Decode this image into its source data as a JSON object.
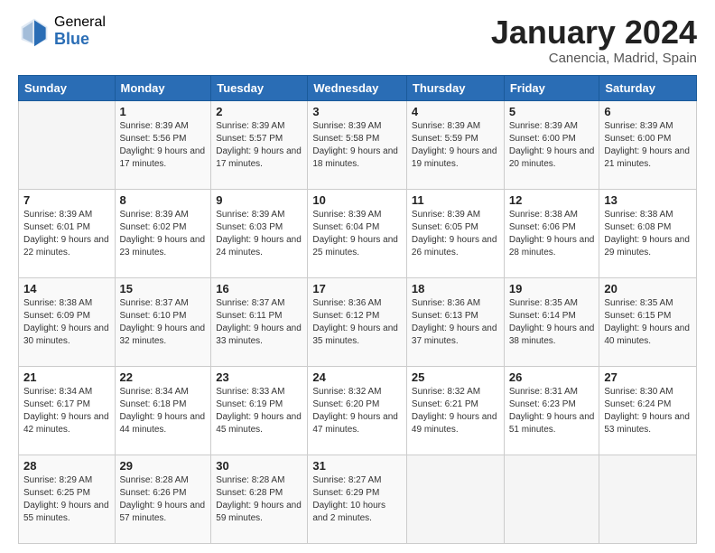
{
  "header": {
    "logo_general": "General",
    "logo_blue": "Blue",
    "month_title": "January 2024",
    "location": "Canencia, Madrid, Spain"
  },
  "weekdays": [
    "Sunday",
    "Monday",
    "Tuesday",
    "Wednesday",
    "Thursday",
    "Friday",
    "Saturday"
  ],
  "weeks": [
    [
      {
        "day": "",
        "sunrise": "",
        "sunset": "",
        "daylight": ""
      },
      {
        "day": "1",
        "sunrise": "Sunrise: 8:39 AM",
        "sunset": "Sunset: 5:56 PM",
        "daylight": "Daylight: 9 hours and 17 minutes."
      },
      {
        "day": "2",
        "sunrise": "Sunrise: 8:39 AM",
        "sunset": "Sunset: 5:57 PM",
        "daylight": "Daylight: 9 hours and 17 minutes."
      },
      {
        "day": "3",
        "sunrise": "Sunrise: 8:39 AM",
        "sunset": "Sunset: 5:58 PM",
        "daylight": "Daylight: 9 hours and 18 minutes."
      },
      {
        "day": "4",
        "sunrise": "Sunrise: 8:39 AM",
        "sunset": "Sunset: 5:59 PM",
        "daylight": "Daylight: 9 hours and 19 minutes."
      },
      {
        "day": "5",
        "sunrise": "Sunrise: 8:39 AM",
        "sunset": "Sunset: 6:00 PM",
        "daylight": "Daylight: 9 hours and 20 minutes."
      },
      {
        "day": "6",
        "sunrise": "Sunrise: 8:39 AM",
        "sunset": "Sunset: 6:00 PM",
        "daylight": "Daylight: 9 hours and 21 minutes."
      }
    ],
    [
      {
        "day": "7",
        "sunrise": "Sunrise: 8:39 AM",
        "sunset": "Sunset: 6:01 PM",
        "daylight": "Daylight: 9 hours and 22 minutes."
      },
      {
        "day": "8",
        "sunrise": "Sunrise: 8:39 AM",
        "sunset": "Sunset: 6:02 PM",
        "daylight": "Daylight: 9 hours and 23 minutes."
      },
      {
        "day": "9",
        "sunrise": "Sunrise: 8:39 AM",
        "sunset": "Sunset: 6:03 PM",
        "daylight": "Daylight: 9 hours and 24 minutes."
      },
      {
        "day": "10",
        "sunrise": "Sunrise: 8:39 AM",
        "sunset": "Sunset: 6:04 PM",
        "daylight": "Daylight: 9 hours and 25 minutes."
      },
      {
        "day": "11",
        "sunrise": "Sunrise: 8:39 AM",
        "sunset": "Sunset: 6:05 PM",
        "daylight": "Daylight: 9 hours and 26 minutes."
      },
      {
        "day": "12",
        "sunrise": "Sunrise: 8:38 AM",
        "sunset": "Sunset: 6:06 PM",
        "daylight": "Daylight: 9 hours and 28 minutes."
      },
      {
        "day": "13",
        "sunrise": "Sunrise: 8:38 AM",
        "sunset": "Sunset: 6:08 PM",
        "daylight": "Daylight: 9 hours and 29 minutes."
      }
    ],
    [
      {
        "day": "14",
        "sunrise": "Sunrise: 8:38 AM",
        "sunset": "Sunset: 6:09 PM",
        "daylight": "Daylight: 9 hours and 30 minutes."
      },
      {
        "day": "15",
        "sunrise": "Sunrise: 8:37 AM",
        "sunset": "Sunset: 6:10 PM",
        "daylight": "Daylight: 9 hours and 32 minutes."
      },
      {
        "day": "16",
        "sunrise": "Sunrise: 8:37 AM",
        "sunset": "Sunset: 6:11 PM",
        "daylight": "Daylight: 9 hours and 33 minutes."
      },
      {
        "day": "17",
        "sunrise": "Sunrise: 8:36 AM",
        "sunset": "Sunset: 6:12 PM",
        "daylight": "Daylight: 9 hours and 35 minutes."
      },
      {
        "day": "18",
        "sunrise": "Sunrise: 8:36 AM",
        "sunset": "Sunset: 6:13 PM",
        "daylight": "Daylight: 9 hours and 37 minutes."
      },
      {
        "day": "19",
        "sunrise": "Sunrise: 8:35 AM",
        "sunset": "Sunset: 6:14 PM",
        "daylight": "Daylight: 9 hours and 38 minutes."
      },
      {
        "day": "20",
        "sunrise": "Sunrise: 8:35 AM",
        "sunset": "Sunset: 6:15 PM",
        "daylight": "Daylight: 9 hours and 40 minutes."
      }
    ],
    [
      {
        "day": "21",
        "sunrise": "Sunrise: 8:34 AM",
        "sunset": "Sunset: 6:17 PM",
        "daylight": "Daylight: 9 hours and 42 minutes."
      },
      {
        "day": "22",
        "sunrise": "Sunrise: 8:34 AM",
        "sunset": "Sunset: 6:18 PM",
        "daylight": "Daylight: 9 hours and 44 minutes."
      },
      {
        "day": "23",
        "sunrise": "Sunrise: 8:33 AM",
        "sunset": "Sunset: 6:19 PM",
        "daylight": "Daylight: 9 hours and 45 minutes."
      },
      {
        "day": "24",
        "sunrise": "Sunrise: 8:32 AM",
        "sunset": "Sunset: 6:20 PM",
        "daylight": "Daylight: 9 hours and 47 minutes."
      },
      {
        "day": "25",
        "sunrise": "Sunrise: 8:32 AM",
        "sunset": "Sunset: 6:21 PM",
        "daylight": "Daylight: 9 hours and 49 minutes."
      },
      {
        "day": "26",
        "sunrise": "Sunrise: 8:31 AM",
        "sunset": "Sunset: 6:23 PM",
        "daylight": "Daylight: 9 hours and 51 minutes."
      },
      {
        "day": "27",
        "sunrise": "Sunrise: 8:30 AM",
        "sunset": "Sunset: 6:24 PM",
        "daylight": "Daylight: 9 hours and 53 minutes."
      }
    ],
    [
      {
        "day": "28",
        "sunrise": "Sunrise: 8:29 AM",
        "sunset": "Sunset: 6:25 PM",
        "daylight": "Daylight: 9 hours and 55 minutes."
      },
      {
        "day": "29",
        "sunrise": "Sunrise: 8:28 AM",
        "sunset": "Sunset: 6:26 PM",
        "daylight": "Daylight: 9 hours and 57 minutes."
      },
      {
        "day": "30",
        "sunrise": "Sunrise: 8:28 AM",
        "sunset": "Sunset: 6:28 PM",
        "daylight": "Daylight: 9 hours and 59 minutes."
      },
      {
        "day": "31",
        "sunrise": "Sunrise: 8:27 AM",
        "sunset": "Sunset: 6:29 PM",
        "daylight": "Daylight: 10 hours and 2 minutes."
      },
      {
        "day": "",
        "sunrise": "",
        "sunset": "",
        "daylight": ""
      },
      {
        "day": "",
        "sunrise": "",
        "sunset": "",
        "daylight": ""
      },
      {
        "day": "",
        "sunrise": "",
        "sunset": "",
        "daylight": ""
      }
    ]
  ]
}
